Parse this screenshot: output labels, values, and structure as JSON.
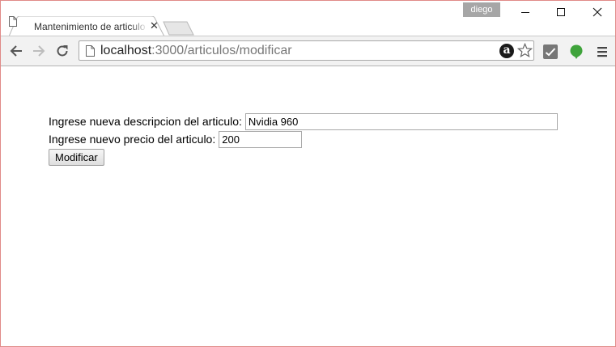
{
  "browser": {
    "tab_title": "Mantenimiento de articulo",
    "tab_close_glyph": "✕",
    "profile_name": "diego",
    "url_host": "localhost",
    "url_path": ":3000/articulos/modificar",
    "icons": [
      "page-icon",
      "back-arrow-icon",
      "forward-arrow-icon",
      "reload-icon",
      "amazon-extension-icon",
      "bookmark-star-icon",
      "extension-check-icon",
      "evernote-extension-icon",
      "menu-icon",
      "minimize-icon",
      "maximize-icon",
      "close-icon"
    ]
  },
  "form": {
    "description_label": "Ingrese nueva descripcion del articulo:",
    "description_value": "Nvidia 960",
    "price_label": "Ingrese nuevo precio del articulo:",
    "price_value": "200",
    "submit_label": "Modificar"
  }
}
